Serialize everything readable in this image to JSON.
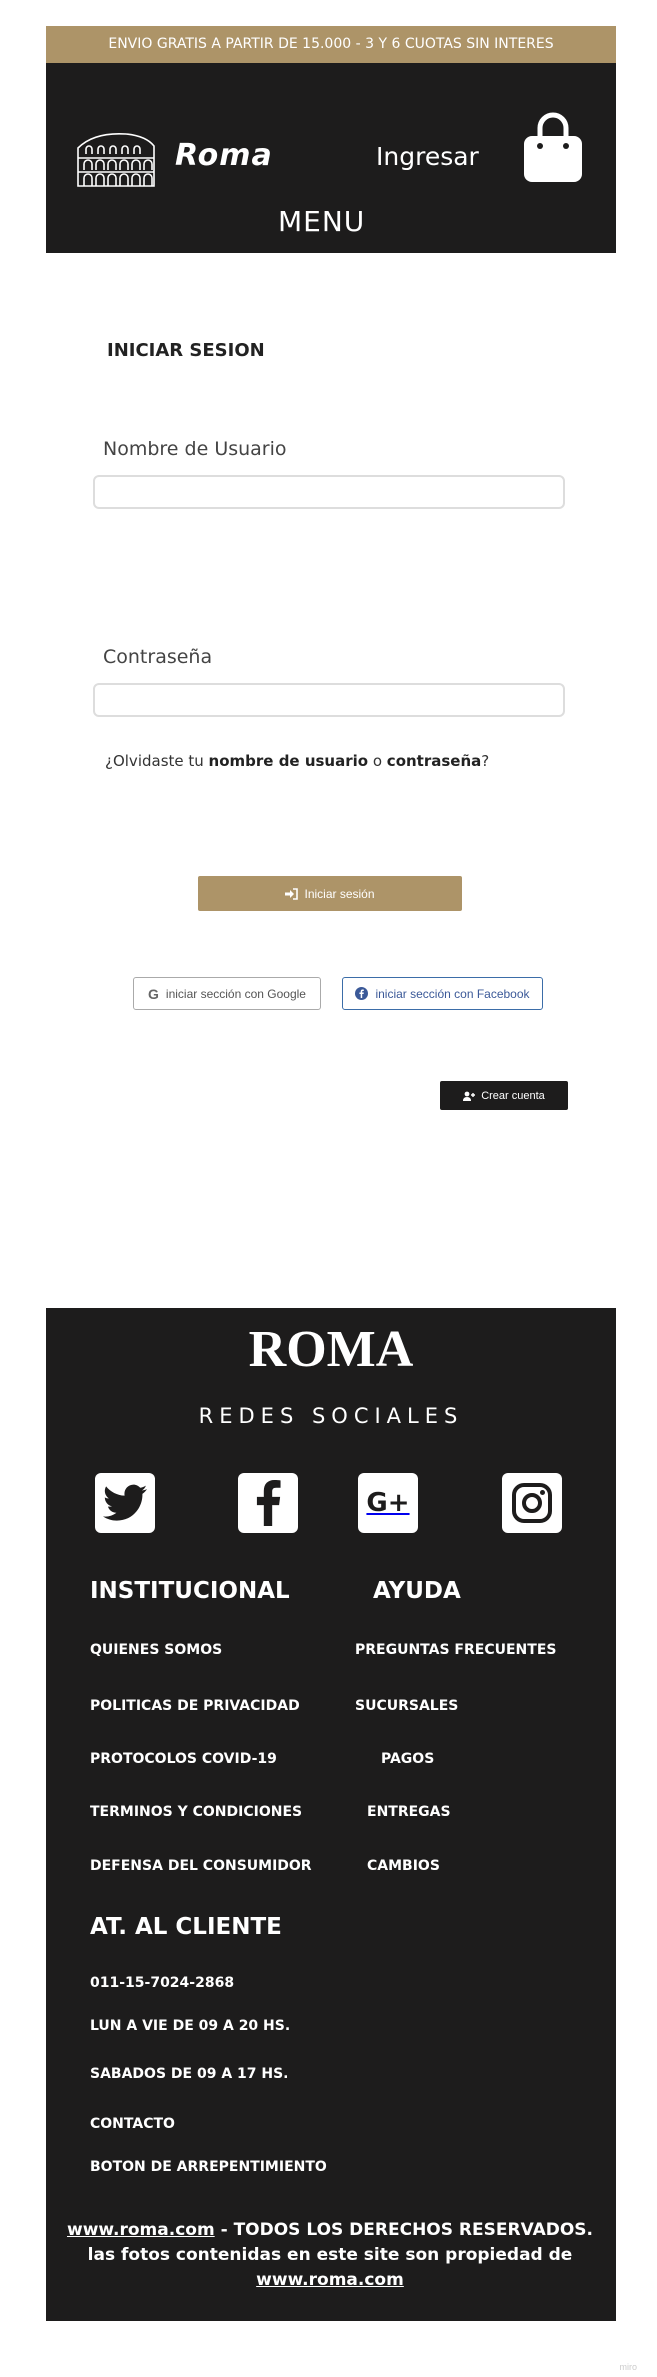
{
  "promo": {
    "text": "ENVIO GRATIS A PARTIR DE 15.000 - 3 Y 6 CUOTAS SIN INTERES"
  },
  "header": {
    "brand": "Roma",
    "login": "Ingresar",
    "menu": "MENU",
    "logo_icon": "colosseum-icon",
    "cart_icon": "shopping-bag-icon"
  },
  "login": {
    "title": "INICIAR SESION",
    "username_label": "Nombre de Usuario",
    "username_value": "",
    "password_label": "Contraseña",
    "password_value": "",
    "forgot_prefix": "¿Olvidaste tu ",
    "forgot_user": "nombre de usuario",
    "forgot_or": " o ",
    "forgot_pass": "contraseña",
    "forgot_suffix": "?",
    "submit": "Iniciar sesión",
    "google": "iniciar sección con Google",
    "facebook": "iniciar sección con Facebook",
    "create": "Crear cuenta"
  },
  "footer": {
    "brand": "ROMA",
    "social_title": "REDES SOCIALES",
    "social_icons": [
      "twitter-icon",
      "facebook-icon",
      "google-plus-icon",
      "instagram-icon"
    ],
    "institucional": {
      "title": "INSTITUCIONAL",
      "links": [
        "QUIENES SOMOS",
        "POLITICAS DE PRIVACIDAD",
        "PROTOCOLOS COVID-19",
        "TERMINOS Y CONDICIONES",
        "DEFENSA DEL CONSUMIDOR"
      ]
    },
    "ayuda": {
      "title": "AYUDA",
      "links": [
        "PREGUNTAS FRECUENTES",
        "SUCURSALES",
        "PAGOS",
        "ENTREGAS",
        "CAMBIOS"
      ]
    },
    "cliente": {
      "title": "AT. AL CLIENTE",
      "items": [
        "011-15-7024-2868",
        "LUN A VIE DE 09 A 20 HS.",
        "SABADOS DE 09 A 17 HS.",
        "CONTACTO",
        "BOTON DE ARREPENTIMIENTO"
      ]
    },
    "copyright": {
      "site1": "www.roma.com",
      "text": " - TODOS LOS DERECHOS RESERVADOS. las fotos contenidas en este site son propiedad de ",
      "site2": "www.roma.com"
    }
  },
  "watermark": "miro",
  "colors": {
    "accent": "#ad9468",
    "dark": "#1d1c1c"
  }
}
